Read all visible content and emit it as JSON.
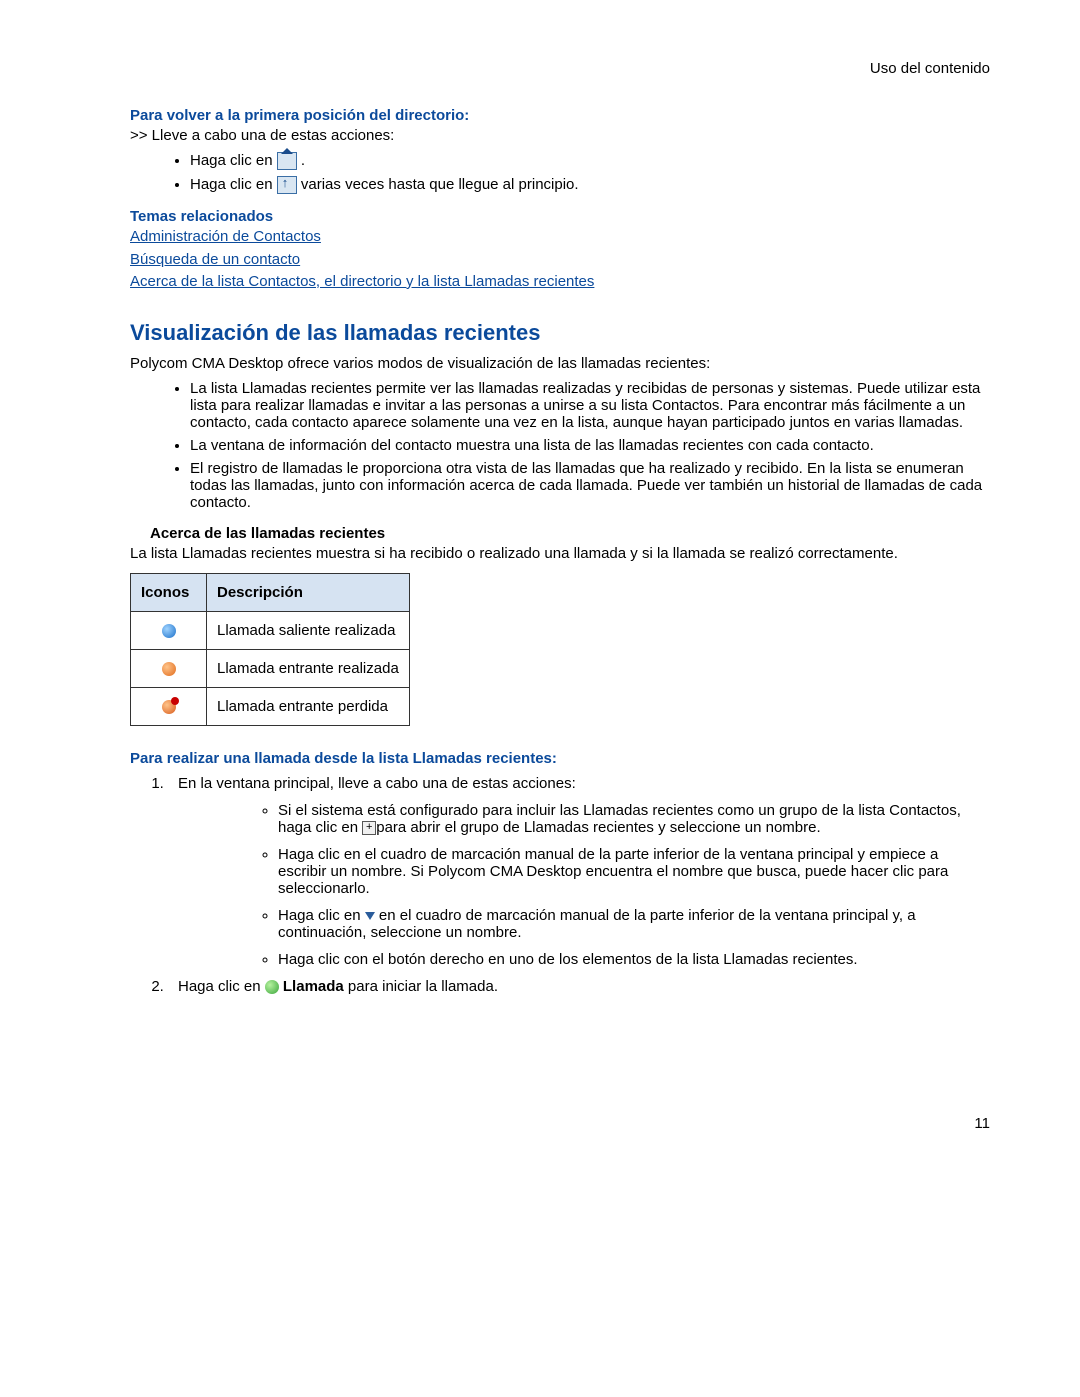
{
  "header": {
    "right": "Uso del contenido"
  },
  "sec1": {
    "title": "Para volver a la primera posición del directorio:",
    "lead": ">> Lleve a cabo una de estas acciones:",
    "b1_pre": "Haga clic en ",
    "b1_post": ".",
    "b2_pre": "Haga clic en ",
    "b2_post": " varias veces hasta que llegue al principio."
  },
  "related": {
    "title": "Temas relacionados",
    "links": {
      "l0": "Administración de Contactos",
      "l1": "Búsqueda de un contacto",
      "l2": "Acerca de la lista Contactos, el directorio y la lista Llamadas recientes"
    }
  },
  "main": {
    "title": "Visualización de las llamadas recientes",
    "intro": "Polycom CMA Desktop ofrece varios modos de visualización de las llamadas recientes:",
    "bullets": {
      "b0": "La lista Llamadas recientes permite ver las llamadas realizadas y recibidas de personas y sistemas. Puede utilizar esta lista para realizar llamadas e invitar a las personas a unirse a su lista Contactos. Para encontrar más fácilmente a un contacto, cada contacto aparece solamente una vez en la lista, aunque hayan participado juntos en varias llamadas.",
      "b1": "La ventana de información del contacto muestra una lista de las llamadas recientes con cada contacto.",
      "b2": "El registro de llamadas le proporciona otra vista de las llamadas que ha realizado y recibido. En la lista se enumeran todas las llamadas, junto con información acerca de cada llamada. Puede ver también un historial de llamadas de cada contacto."
    },
    "about": {
      "title": "Acerca de las llamadas recientes",
      "text": " La lista Llamadas recientes muestra si ha recibido o realizado una llamada y si la llamada se realizó correctamente."
    }
  },
  "table": {
    "h0": "Iconos",
    "h1": "Descripción",
    "r0": "Llamada saliente realizada",
    "r1": "Llamada entrante realizada",
    "r2": "Llamada entrante perdida"
  },
  "proc": {
    "title": "Para realizar una llamada desde la lista Llamadas recientes:",
    "s1": "En la ventana principal, lleve a cabo una de estas acciones:",
    "s1b0_pre": "Si el sistema está configurado para incluir las Llamadas recientes como un grupo de la lista Contactos, haga clic en ",
    "s1b0_post": "para abrir el grupo de Llamadas recientes y seleccione un nombre.",
    "s1b1": "Haga clic en el cuadro de marcación manual de la parte inferior de la ventana principal y empiece a escribir un nombre. Si Polycom CMA Desktop encuentra el nombre que busca, puede hacer clic para seleccionarlo.",
    "s1b2_pre": "Haga clic en ",
    "s1b2_post": " en el cuadro de marcación manual de la parte inferior de la ventana principal y, a continuación, seleccione un nombre.",
    "s1b3": "Haga clic con el botón derecho en uno de los elementos de la lista Llamadas recientes.",
    "s2_pre": "Haga clic en ",
    "s2_mid": "Llamada",
    "s2_post": " para iniciar la llamada."
  },
  "footer": {
    "page": "11"
  }
}
